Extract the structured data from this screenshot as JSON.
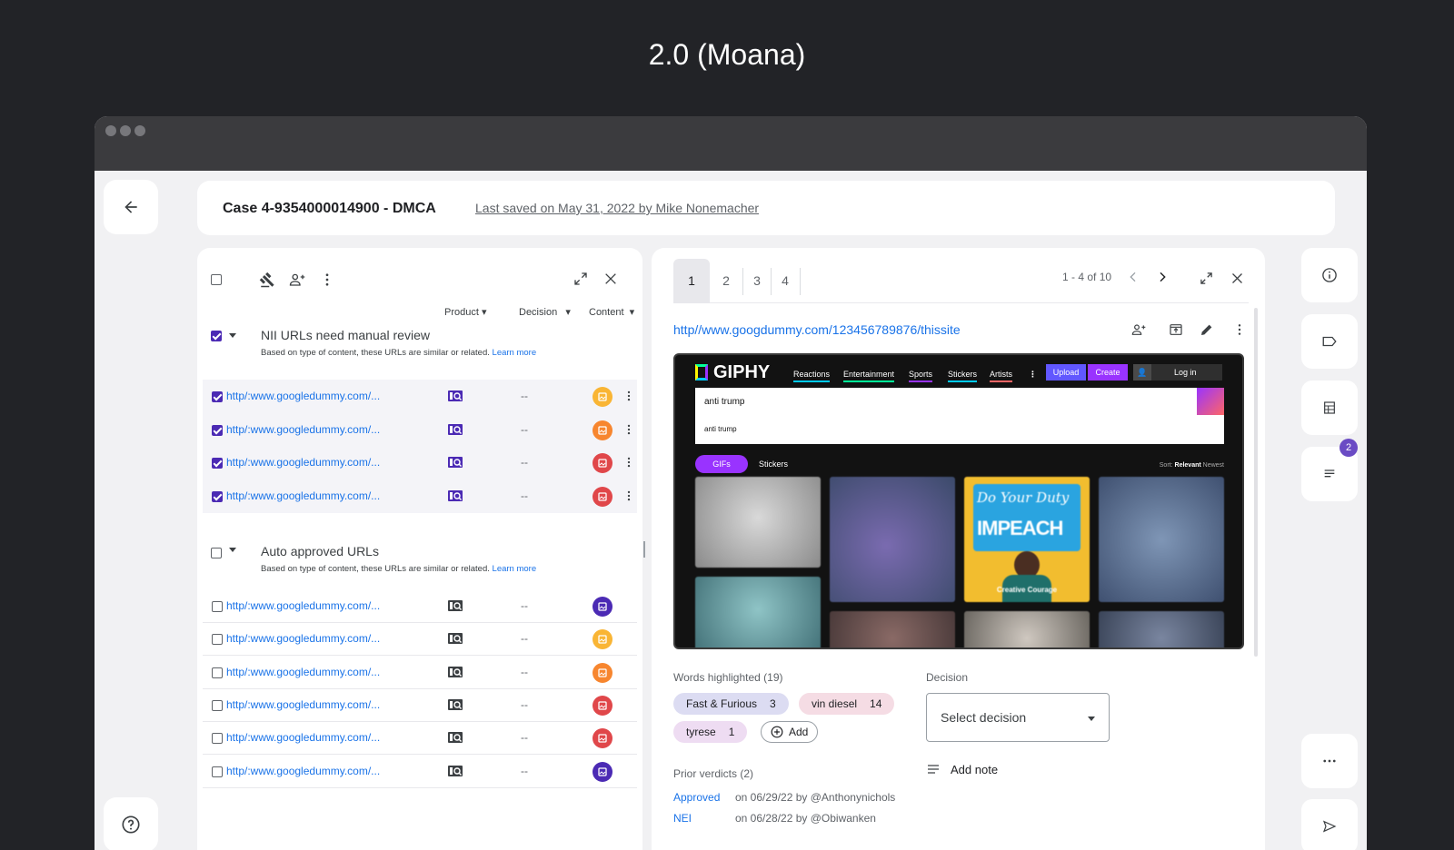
{
  "page_heading": "2.0 (Moana)",
  "header": {
    "case_title": "Case 4-9354000014900 - DMCA",
    "last_saved": "Last saved on May 31, 2022 by Mike Nonemacher"
  },
  "left_panel": {
    "columns": {
      "product": "Product",
      "decision": "Decision",
      "content": "Content"
    },
    "groups": [
      {
        "title": "NII URLs need manual review",
        "subtitle": "Based on type of content, these URLs are similar or related.",
        "learn_more": "Learn more",
        "rows": [
          {
            "url": "http/:www.googledummy.com/...",
            "decision": "--",
            "badge_color": "#f9b535"
          },
          {
            "url": "http/:www.googledummy.com/...",
            "decision": "--",
            "badge_color": "#f7862f"
          },
          {
            "url": "http/:www.googledummy.com/...",
            "decision": "--",
            "badge_color": "#e0474a"
          },
          {
            "url": "http/:www.googledummy.com/...",
            "decision": "--",
            "badge_color": "#e0474a"
          }
        ]
      },
      {
        "title": "Auto approved URLs",
        "subtitle": "Based on type of content, these URLs are similar or related.",
        "learn_more": "Learn more",
        "rows": [
          {
            "url": "http/:www.googledummy.com/...",
            "decision": "--",
            "badge_color": "#4b2ab4"
          },
          {
            "url": "http/:www.googledummy.com/...",
            "decision": "--",
            "badge_color": "#f9b535"
          },
          {
            "url": "http/:www.googledummy.com/...",
            "decision": "--",
            "badge_color": "#f7862f"
          },
          {
            "url": "http/:www.googledummy.com/...",
            "decision": "--",
            "badge_color": "#e0474a"
          },
          {
            "url": "http/:www.googledummy.com/...",
            "decision": "--",
            "badge_color": "#e0474a"
          },
          {
            "url": "http/:www.googledummy.com/...",
            "decision": "--",
            "badge_color": "#4b2ab4"
          }
        ]
      }
    ]
  },
  "detail_panel": {
    "tabs": [
      "1",
      "2",
      "3",
      "4"
    ],
    "pagination": "1 - 4 of 10",
    "url": "http//www.googdummy.com/123456789876/thissite",
    "screenshot": {
      "logo": "GIPHY",
      "nav": [
        "Reactions",
        "Entertainment",
        "Sports",
        "Stickers",
        "Artists"
      ],
      "upload": "Upload",
      "create": "Create",
      "login": "Log in",
      "search_value": "anti trump",
      "suggestion": "anti trump",
      "pill_gifs": "GIFs",
      "pill_stickers": "Stickers",
      "sort_label": "Sort:",
      "sort_relevant": "Relevant",
      "sort_newest": "Newest",
      "poster_line1": "Do Your Duty",
      "poster_line2": "IMPEACH",
      "poster_caption": "Creative Courage"
    },
    "words_highlighted_label": "Words highlighted (19)",
    "chips": [
      {
        "label": "Fast & Furious",
        "count": "3"
      },
      {
        "label": "vin diesel",
        "count": "14"
      },
      {
        "label": "tyrese",
        "count": "1"
      }
    ],
    "add_label": "Add",
    "decision_label": "Decision",
    "decision_placeholder": "Select decision",
    "add_note": "Add note",
    "prior_verdicts_label": "Prior verdicts (2)",
    "verdicts": [
      {
        "status": "Approved",
        "text": "on 06/29/22 by @Anthonynichols"
      },
      {
        "status": "NEI",
        "text": "on 06/28/22 by @Obiwanken"
      }
    ]
  },
  "right_rail": {
    "notification_count": "2"
  }
}
